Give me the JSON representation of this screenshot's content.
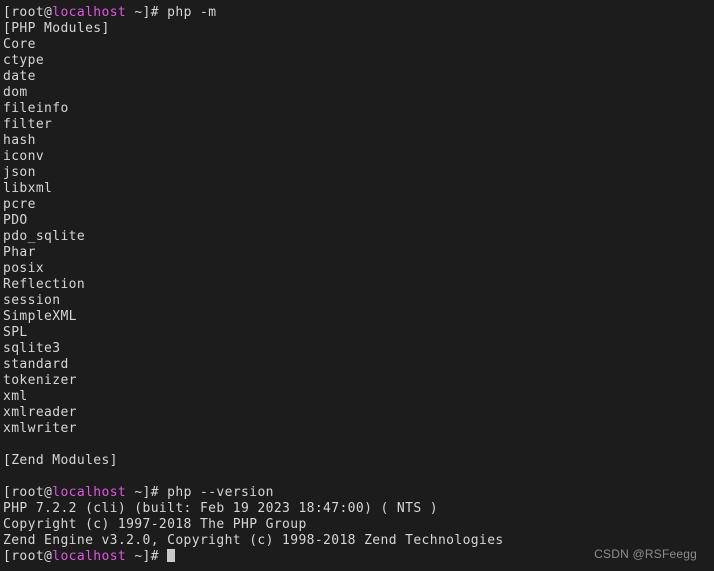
{
  "terminal": {
    "background_color": "#1c1c1c",
    "foreground_color": "#d6d6d6",
    "hostname_color": "#e254e2",
    "cursor_color": "#c9c9c9",
    "prompt_user_prefix": "[root@",
    "prompt_hostname": "localhost",
    "prompt_suffix": " ~]# ",
    "lines": [
      {
        "type": "prompt",
        "command": "php -m"
      },
      {
        "type": "output",
        "text": "[PHP Modules]"
      },
      {
        "type": "output",
        "text": "Core"
      },
      {
        "type": "output",
        "text": "ctype"
      },
      {
        "type": "output",
        "text": "date"
      },
      {
        "type": "output",
        "text": "dom"
      },
      {
        "type": "output",
        "text": "fileinfo"
      },
      {
        "type": "output",
        "text": "filter"
      },
      {
        "type": "output",
        "text": "hash"
      },
      {
        "type": "output",
        "text": "iconv"
      },
      {
        "type": "output",
        "text": "json"
      },
      {
        "type": "output",
        "text": "libxml"
      },
      {
        "type": "output",
        "text": "pcre"
      },
      {
        "type": "output",
        "text": "PDO"
      },
      {
        "type": "output",
        "text": "pdo_sqlite"
      },
      {
        "type": "output",
        "text": "Phar"
      },
      {
        "type": "output",
        "text": "posix"
      },
      {
        "type": "output",
        "text": "Reflection"
      },
      {
        "type": "output",
        "text": "session"
      },
      {
        "type": "output",
        "text": "SimpleXML"
      },
      {
        "type": "output",
        "text": "SPL"
      },
      {
        "type": "output",
        "text": "sqlite3"
      },
      {
        "type": "output",
        "text": "standard"
      },
      {
        "type": "output",
        "text": "tokenizer"
      },
      {
        "type": "output",
        "text": "xml"
      },
      {
        "type": "output",
        "text": "xmlreader"
      },
      {
        "type": "output",
        "text": "xmlwriter"
      },
      {
        "type": "blank",
        "text": ""
      },
      {
        "type": "output",
        "text": "[Zend Modules]"
      },
      {
        "type": "blank",
        "text": ""
      },
      {
        "type": "prompt",
        "command": "php --version"
      },
      {
        "type": "output",
        "text": "PHP 7.2.2 (cli) (built: Feb 19 2023 18:47:00) ( NTS )"
      },
      {
        "type": "output",
        "text": "Copyright (c) 1997-2018 The PHP Group"
      },
      {
        "type": "output",
        "text": "Zend Engine v3.2.0, Copyright (c) 1998-2018 Zend Technologies"
      },
      {
        "type": "prompt",
        "command": "",
        "cursor": true
      }
    ]
  },
  "watermark": {
    "text": "CSDN @RSFeegg",
    "color": "#8d8d8d"
  }
}
